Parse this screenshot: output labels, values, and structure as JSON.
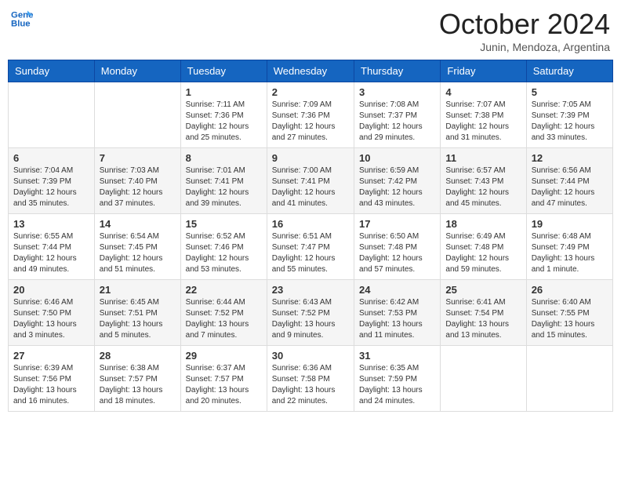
{
  "header": {
    "logo_line1": "General",
    "logo_line2": "Blue",
    "month": "October 2024",
    "location": "Junin, Mendoza, Argentina"
  },
  "weekdays": [
    "Sunday",
    "Monday",
    "Tuesday",
    "Wednesday",
    "Thursday",
    "Friday",
    "Saturday"
  ],
  "weeks": [
    [
      {
        "day": "",
        "info": ""
      },
      {
        "day": "",
        "info": ""
      },
      {
        "day": "1",
        "info": "Sunrise: 7:11 AM\nSunset: 7:36 PM\nDaylight: 12 hours and 25 minutes."
      },
      {
        "day": "2",
        "info": "Sunrise: 7:09 AM\nSunset: 7:36 PM\nDaylight: 12 hours and 27 minutes."
      },
      {
        "day": "3",
        "info": "Sunrise: 7:08 AM\nSunset: 7:37 PM\nDaylight: 12 hours and 29 minutes."
      },
      {
        "day": "4",
        "info": "Sunrise: 7:07 AM\nSunset: 7:38 PM\nDaylight: 12 hours and 31 minutes."
      },
      {
        "day": "5",
        "info": "Sunrise: 7:05 AM\nSunset: 7:39 PM\nDaylight: 12 hours and 33 minutes."
      }
    ],
    [
      {
        "day": "6",
        "info": "Sunrise: 7:04 AM\nSunset: 7:39 PM\nDaylight: 12 hours and 35 minutes."
      },
      {
        "day": "7",
        "info": "Sunrise: 7:03 AM\nSunset: 7:40 PM\nDaylight: 12 hours and 37 minutes."
      },
      {
        "day": "8",
        "info": "Sunrise: 7:01 AM\nSunset: 7:41 PM\nDaylight: 12 hours and 39 minutes."
      },
      {
        "day": "9",
        "info": "Sunrise: 7:00 AM\nSunset: 7:41 PM\nDaylight: 12 hours and 41 minutes."
      },
      {
        "day": "10",
        "info": "Sunrise: 6:59 AM\nSunset: 7:42 PM\nDaylight: 12 hours and 43 minutes."
      },
      {
        "day": "11",
        "info": "Sunrise: 6:57 AM\nSunset: 7:43 PM\nDaylight: 12 hours and 45 minutes."
      },
      {
        "day": "12",
        "info": "Sunrise: 6:56 AM\nSunset: 7:44 PM\nDaylight: 12 hours and 47 minutes."
      }
    ],
    [
      {
        "day": "13",
        "info": "Sunrise: 6:55 AM\nSunset: 7:44 PM\nDaylight: 12 hours and 49 minutes."
      },
      {
        "day": "14",
        "info": "Sunrise: 6:54 AM\nSunset: 7:45 PM\nDaylight: 12 hours and 51 minutes."
      },
      {
        "day": "15",
        "info": "Sunrise: 6:52 AM\nSunset: 7:46 PM\nDaylight: 12 hours and 53 minutes."
      },
      {
        "day": "16",
        "info": "Sunrise: 6:51 AM\nSunset: 7:47 PM\nDaylight: 12 hours and 55 minutes."
      },
      {
        "day": "17",
        "info": "Sunrise: 6:50 AM\nSunset: 7:48 PM\nDaylight: 12 hours and 57 minutes."
      },
      {
        "day": "18",
        "info": "Sunrise: 6:49 AM\nSunset: 7:48 PM\nDaylight: 12 hours and 59 minutes."
      },
      {
        "day": "19",
        "info": "Sunrise: 6:48 AM\nSunset: 7:49 PM\nDaylight: 13 hours and 1 minute."
      }
    ],
    [
      {
        "day": "20",
        "info": "Sunrise: 6:46 AM\nSunset: 7:50 PM\nDaylight: 13 hours and 3 minutes."
      },
      {
        "day": "21",
        "info": "Sunrise: 6:45 AM\nSunset: 7:51 PM\nDaylight: 13 hours and 5 minutes."
      },
      {
        "day": "22",
        "info": "Sunrise: 6:44 AM\nSunset: 7:52 PM\nDaylight: 13 hours and 7 minutes."
      },
      {
        "day": "23",
        "info": "Sunrise: 6:43 AM\nSunset: 7:52 PM\nDaylight: 13 hours and 9 minutes."
      },
      {
        "day": "24",
        "info": "Sunrise: 6:42 AM\nSunset: 7:53 PM\nDaylight: 13 hours and 11 minutes."
      },
      {
        "day": "25",
        "info": "Sunrise: 6:41 AM\nSunset: 7:54 PM\nDaylight: 13 hours and 13 minutes."
      },
      {
        "day": "26",
        "info": "Sunrise: 6:40 AM\nSunset: 7:55 PM\nDaylight: 13 hours and 15 minutes."
      }
    ],
    [
      {
        "day": "27",
        "info": "Sunrise: 6:39 AM\nSunset: 7:56 PM\nDaylight: 13 hours and 16 minutes."
      },
      {
        "day": "28",
        "info": "Sunrise: 6:38 AM\nSunset: 7:57 PM\nDaylight: 13 hours and 18 minutes."
      },
      {
        "day": "29",
        "info": "Sunrise: 6:37 AM\nSunset: 7:57 PM\nDaylight: 13 hours and 20 minutes."
      },
      {
        "day": "30",
        "info": "Sunrise: 6:36 AM\nSunset: 7:58 PM\nDaylight: 13 hours and 22 minutes."
      },
      {
        "day": "31",
        "info": "Sunrise: 6:35 AM\nSunset: 7:59 PM\nDaylight: 13 hours and 24 minutes."
      },
      {
        "day": "",
        "info": ""
      },
      {
        "day": "",
        "info": ""
      }
    ]
  ]
}
